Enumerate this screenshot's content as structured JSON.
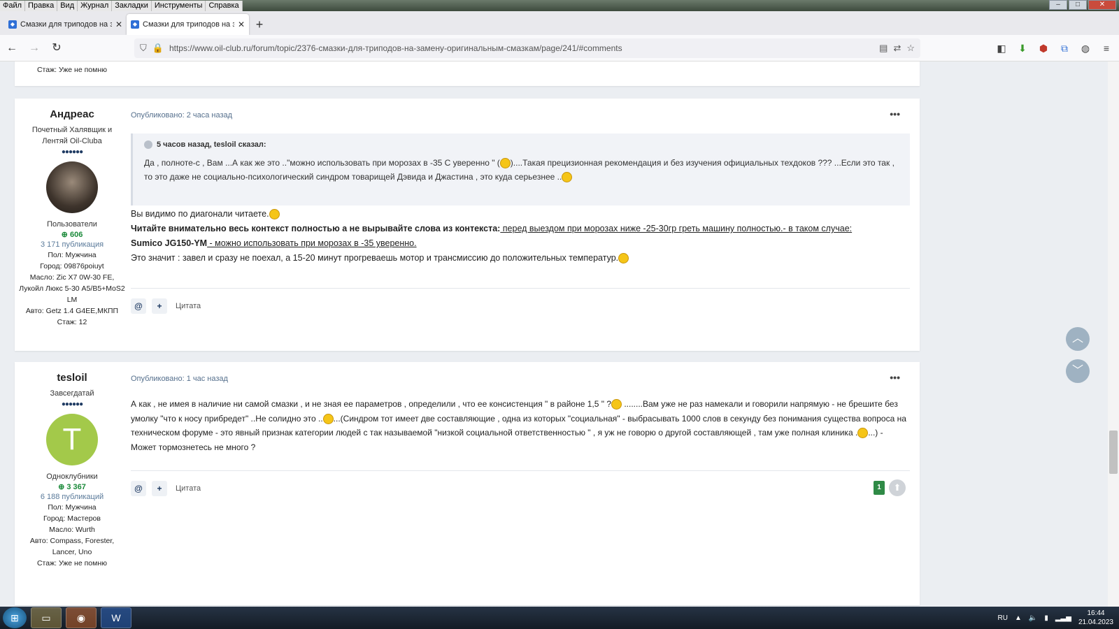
{
  "menu": [
    "Файл",
    "Правка",
    "Вид",
    "Журнал",
    "Закладки",
    "Инструменты",
    "Справка"
  ],
  "tabs": [
    {
      "title": "Смазки для триподов на заме"
    },
    {
      "title": "Смазки для триподов на заме"
    }
  ],
  "nav": {
    "url": "https://www.oil-club.ru/forum/topic/2376-смазки-для-триподов-на-замену-оригинальным-смазкам/page/241/#comments"
  },
  "prev_post_tail": {
    "field": "Стаж: Уже не помню"
  },
  "post1": {
    "author": "Андреас",
    "rank": "Почетный Халявщик и Лентяй Oil-Cluba",
    "group": "Пользователи",
    "reputation": "606",
    "publications": "3 171 публикация",
    "fields": [
      "Пол: Мужчина",
      "Город: 09876poiuyt",
      "Масло: Zic X7 0W-30 FE, Лукойл Люкс 5-30 A5/B5+MoS2 LM",
      "Авто: Getz 1.4 G4EE,МКПП",
      "Стаж: 12"
    ],
    "published": "Опубликовано: 2 часа назад",
    "quote_header": "5 часов назад, tesloil сказал:",
    "quote_text_1": "Да , полноте-с , Вам ...А как же это ..\"можно использовать при морозах в -35 С уверенно \" (",
    "quote_text_2": ")....Такая прецизионная рекомендация и без изучения официальных техдоков ??? ...Если это так , то это даже не социально-психологический синдром товарищей Дэвида и Джастина , это куда серьезнее ..",
    "line1": "Вы видимо по диагонали читаете.",
    "line2_bold": "Читайте внимательно  весь контекст полностью а не вырывайте слова из контекста:",
    "line2_link": " перед выездом при морозах ниже -25-30гр греть машину полностью.- в таком случае:",
    "line3_bold": "Sumico JG150-YM",
    "line3_link": " - можно использовать при морозах в -35 уверенно.",
    "line4": "Это значит : завел и сразу не поехал, а 15-20 минут прогреваешь мотор и трансмиссию до положительных температур.",
    "cite_label": "Цитата"
  },
  "post2": {
    "author": "tesloil",
    "rank": "Завсегдатай",
    "avatar_letter": "T",
    "avatar_color": "#a3c94a",
    "group": "Одноклубники",
    "reputation": "3 367",
    "publications": "6 188 публикаций",
    "fields": [
      "Пол: Мужчина",
      "Город: Мастеров",
      "Масло: Wurth",
      "Авто: Compass, Forester, Lancer, Uno",
      "Стаж: Уже не помню"
    ],
    "published": "Опубликовано: 1 час назад",
    "text_a": "А как , не имея в наличие ни самой смазки , и не зная ее параметров , определили , что ее консистенция           \" в районе 1,5 \" ?",
    "text_b": " ........Вам уже не раз намекали и говорили напрямую - не брешите без умолку \"что к носу прибредет\"  ..Не солидно это ..",
    "text_c": "...(Синдром тот имеет две составляющие , одна из которых \"социальная\" - выбрасывать 1000 слов в секунду без понимания существа вопроса на техническом форуме - это явный признак категории людей с так называемой \"низкой социальной ответственностью \" , я уж не говорю о другой составляющей , там уже полная клиника .",
    "text_d": "...) - Может тормознетесь не много ?",
    "cite_label": "Цитата",
    "votes": "1"
  },
  "taskbar": {
    "lang": "RU",
    "time": "16:44",
    "date": "21.04.2023"
  }
}
